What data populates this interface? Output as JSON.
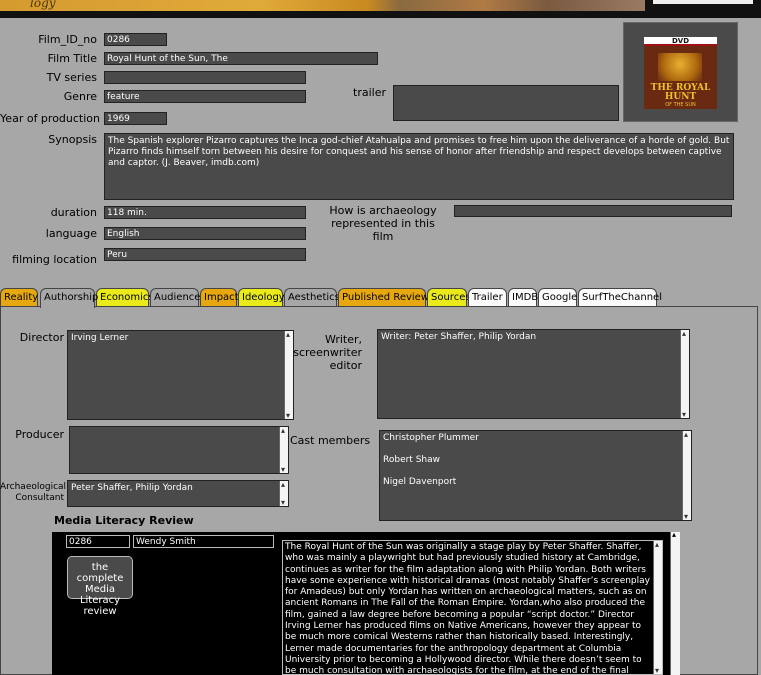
{
  "banner": {
    "text": "logy"
  },
  "fields": {
    "film_id": {
      "label": "Film_ID_no",
      "value": "0286"
    },
    "title": {
      "label": "Film Title",
      "value": "Royal Hunt of the Sun, The"
    },
    "tv_series": {
      "label": "TV series",
      "value": ""
    },
    "genre": {
      "label": "Genre",
      "value": "feature"
    },
    "year": {
      "label": "Year of production",
      "value": "1969"
    },
    "trailer": {
      "label": "trailer",
      "value": ""
    },
    "synopsis": {
      "label": "Synopsis",
      "value": "The Spanish explorer Pizarro captures the Inca god-chief Atahualpa and promises to free him upon the deliverance of a horde of gold. But Pizarro finds himself torn between his desire for conquest and his sense of honor after friendship and respect develops between captive and captor. (J. Beaver, imdb.com)"
    },
    "duration": {
      "label": "duration",
      "value": "118 min."
    },
    "language": {
      "label": "language",
      "value": "English"
    },
    "filming_location": {
      "label": "filming location",
      "value": "Peru"
    },
    "archaeology": {
      "label": "How is archaeology represented in this film",
      "value": ""
    }
  },
  "poster": {
    "badge": "DVD",
    "title": "THE ROYAL HUNT",
    "sub": "OF THE SUN"
  },
  "tabs": [
    {
      "label": "Reality",
      "color": "#e7a80f"
    },
    {
      "label": "Authorship",
      "color": "#a7a7a7"
    },
    {
      "label": "Economics",
      "color": "#eaea1a"
    },
    {
      "label": "Audience",
      "color": "#a7a7a7"
    },
    {
      "label": "Impact",
      "color": "#e7a80f"
    },
    {
      "label": "Ideology",
      "color": "#eaea1a"
    },
    {
      "label": "Aesthetics",
      "color": "#a7a7a7"
    },
    {
      "label": "Published Reviews",
      "color": "#e7a80f"
    },
    {
      "label": "Sources",
      "color": "#eaea1a"
    },
    {
      "label": "Trailer",
      "color": "#fafafa"
    },
    {
      "label": "IMDB",
      "color": "#fafafa"
    },
    {
      "label": "Google",
      "color": "#fafafa"
    },
    {
      "label": "SurfTheChannel",
      "color": "#fafafa"
    }
  ],
  "authorship": {
    "director": {
      "label": "Director",
      "value": "Irving Lerner"
    },
    "writer": {
      "label": "Writer, screenwriter editor",
      "value": "Writer: Peter Shaffer, Philip Yordan"
    },
    "producer": {
      "label": "Producer",
      "value": ""
    },
    "cast": {
      "label": "Cast members",
      "values": [
        "Christopher Plummer",
        "Robert Shaw",
        "Nigel Davenport"
      ]
    },
    "consultant": {
      "label": "Archaeological Consultant",
      "value": "Peter Shaffer, Philip Yordan"
    }
  },
  "review": {
    "heading": "Media Literacy Review",
    "id": "0286",
    "author": "Wendy Smith",
    "button": "the complete Media Literacy review",
    "text": "The Royal Hunt of the Sun was originally a stage play by Peter Shaffer.  Shaffer, who was mainly a playwright but had previously studied history at Cambridge, continues as writer for the film adaptation along with Philip Yordan.  Both writers have some experience with historical dramas (most notably Shaffer’s screenplay for Amadeus) but only Yordan has written on archaeological matters, such as on ancient Romans in The Fall of the Roman Empire.  Yordan,who also produced the film, gained a law degree before becoming a popular “script doctor.”  Director Irving Lerner has produced films on Native Americans, however they appear to be much more comical Westerns rather than historically based.  Interestingly, Lerner made documentaries for the anthropology department at Columbia University prior to becoming a Hollywood director.  While there doesn’t seem to be much consultation with archaeologists for the film, at the end of the final credits El Museo Rafael Larco de"
  }
}
